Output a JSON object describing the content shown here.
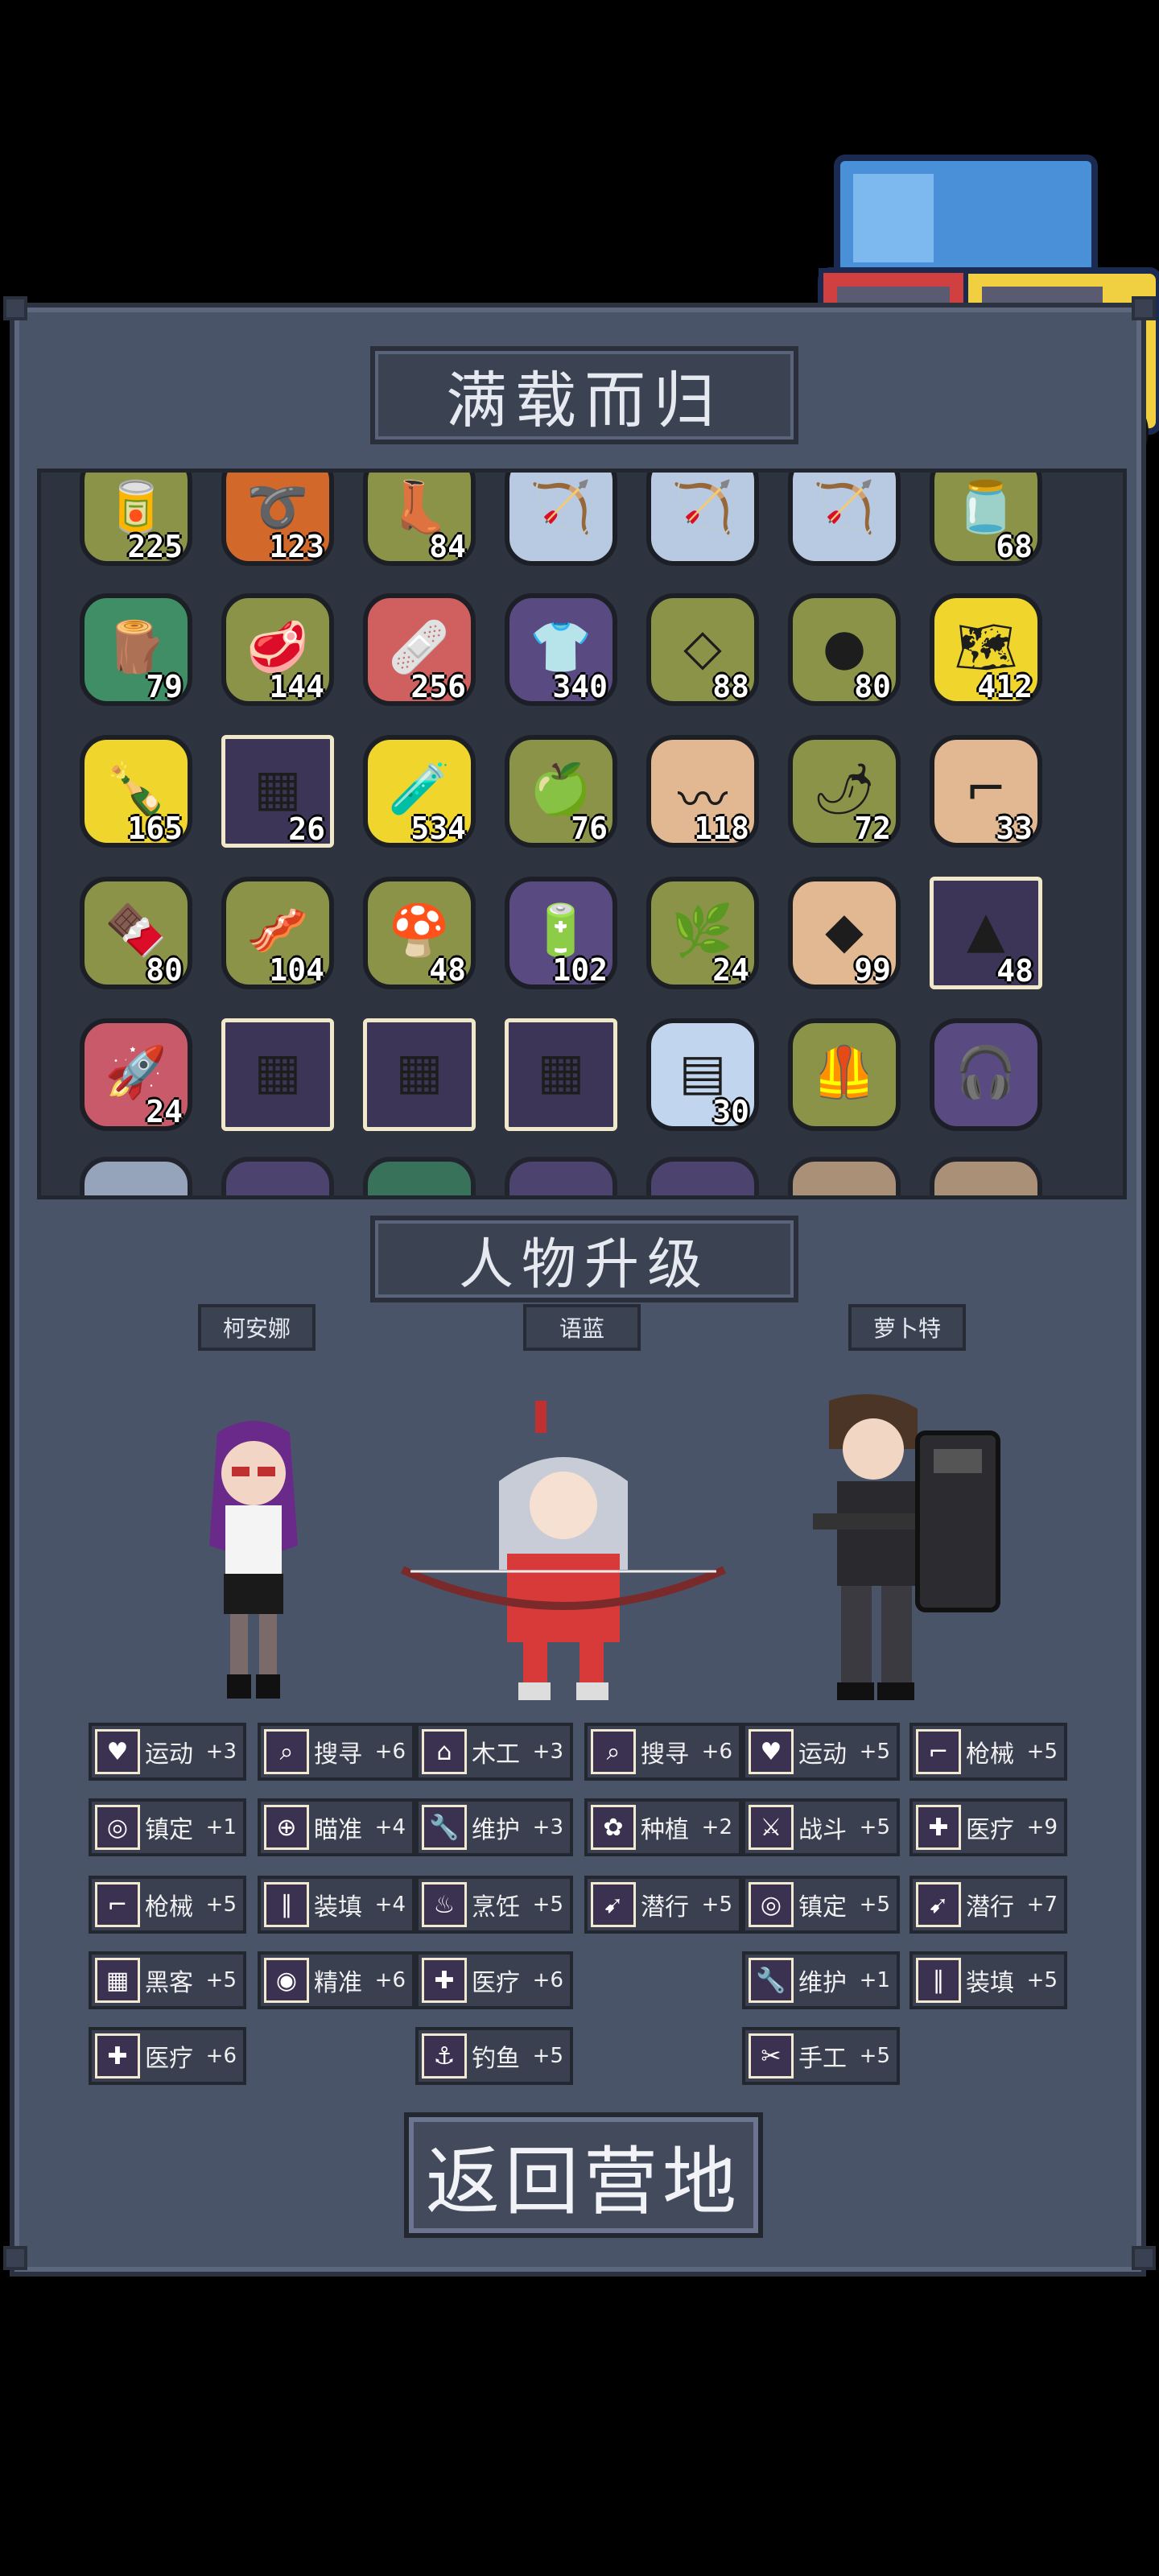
{
  "header": {
    "title": "满载而归"
  },
  "items": [
    {
      "icon": "food-can-icon",
      "glyph": "🥫",
      "color": "c-olive",
      "count": "225"
    },
    {
      "icon": "rope-icon",
      "glyph": "➰",
      "color": "c-orange",
      "count": "123"
    },
    {
      "icon": "boots-icon",
      "glyph": "👢",
      "color": "c-olive",
      "count": "84"
    },
    {
      "icon": "bow-icon",
      "glyph": "🏹",
      "color": "c-blue",
      "count": ""
    },
    {
      "icon": "bow-icon",
      "glyph": "🏹",
      "color": "c-blue",
      "count": ""
    },
    {
      "icon": "bow-icon",
      "glyph": "🏹",
      "color": "c-blue",
      "count": ""
    },
    {
      "icon": "jar-icon",
      "glyph": "🫙",
      "color": "c-olive",
      "count": "68"
    },
    {
      "icon": "wood-log-icon",
      "glyph": "🪵",
      "color": "c-green",
      "count": "79"
    },
    {
      "icon": "meat-icon",
      "glyph": "🥩",
      "color": "c-olive",
      "count": "144"
    },
    {
      "icon": "medkit-icon",
      "glyph": "🩹",
      "color": "c-red",
      "count": "256"
    },
    {
      "icon": "shirt-icon",
      "glyph": "👕",
      "color": "c-purple",
      "count": "340"
    },
    {
      "icon": "cloth-icon",
      "glyph": "◇",
      "color": "c-olive",
      "count": "88"
    },
    {
      "icon": "stone-icon",
      "glyph": "●",
      "color": "c-olive",
      "count": "80"
    },
    {
      "icon": "map-icon",
      "glyph": "🗺",
      "color": "c-yellow",
      "count": "412"
    },
    {
      "icon": "bottle-icon",
      "glyph": "🍾",
      "color": "c-yellow",
      "count": "165"
    },
    {
      "icon": "chip-icon",
      "glyph": "▦",
      "color": "c-chip",
      "count": "26"
    },
    {
      "icon": "potion-icon",
      "glyph": "🧪",
      "color": "c-yellow",
      "count": "534"
    },
    {
      "icon": "fruit-icon",
      "glyph": "🍏",
      "color": "c-olive",
      "count": "76"
    },
    {
      "icon": "wire-icon",
      "glyph": "〰",
      "color": "c-tan",
      "count": "118"
    },
    {
      "icon": "pepper-icon",
      "glyph": "🌶",
      "color": "c-olive",
      "count": "72"
    },
    {
      "icon": "rifle-icon",
      "glyph": "⌐",
      "color": "c-tan",
      "count": "33"
    },
    {
      "icon": "chocolate-icon",
      "glyph": "🍫",
      "color": "c-olive",
      "count": "80"
    },
    {
      "icon": "raw-meat-icon",
      "glyph": "🥓",
      "color": "c-olive",
      "count": "104"
    },
    {
      "icon": "mushroom-icon",
      "glyph": "🍄",
      "color": "c-olive",
      "count": "48"
    },
    {
      "icon": "battery-icon",
      "glyph": "🔋",
      "color": "c-purple",
      "count": "102"
    },
    {
      "icon": "herb-icon",
      "glyph": "🌿",
      "color": "c-olive",
      "count": "24"
    },
    {
      "icon": "ore-icon",
      "glyph": "◆",
      "color": "c-tan",
      "count": "99"
    },
    {
      "icon": "crystal-chip-icon",
      "glyph": "▲",
      "color": "c-chip",
      "count": "48"
    },
    {
      "icon": "rocket-icon",
      "glyph": "🚀",
      "color": "c-pink",
      "count": "24"
    },
    {
      "icon": "chip-icon",
      "glyph": "▦",
      "color": "c-chip",
      "count": ""
    },
    {
      "icon": "chip-icon",
      "glyph": "▦",
      "color": "c-chip",
      "count": ""
    },
    {
      "icon": "chip-icon",
      "glyph": "▦",
      "color": "c-chip",
      "count": ""
    },
    {
      "icon": "circuit-board-icon",
      "glyph": "▤",
      "color": "c-lightblue",
      "count": "30"
    },
    {
      "icon": "armor-vest-icon",
      "glyph": "🦺",
      "color": "c-olive",
      "count": ""
    },
    {
      "icon": "headphones-icon",
      "glyph": "🎧",
      "color": "c-purple",
      "count": ""
    }
  ],
  "upgrade": {
    "title": "人物升级"
  },
  "characters": [
    {
      "name": "柯安娜"
    },
    {
      "name": "语蓝"
    },
    {
      "name": "萝卜特"
    }
  ],
  "skills": {
    "col1": [
      {
        "icon": "heart-icon",
        "glyph": "♥",
        "name": "运动",
        "val": "+3"
      },
      {
        "icon": "glasses-icon",
        "glyph": "◎",
        "name": "镇定",
        "val": "+1"
      },
      {
        "icon": "gun-icon",
        "glyph": "⌐",
        "name": "枪械",
        "val": "+5"
      },
      {
        "icon": "hacker-icon",
        "glyph": "▦",
        "name": "黑客",
        "val": "+5"
      },
      {
        "icon": "medical-icon",
        "glyph": "✚",
        "name": "医疗",
        "val": "+6"
      }
    ],
    "col2": [
      {
        "icon": "magnifier-icon",
        "glyph": "⌕",
        "name": "搜寻",
        "val": "+6"
      },
      {
        "icon": "crosshair-icon",
        "glyph": "⊕",
        "name": "瞄准",
        "val": "+4"
      },
      {
        "icon": "ammo-icon",
        "glyph": "∥",
        "name": "装填",
        "val": "+4"
      },
      {
        "icon": "eye-icon",
        "glyph": "◉",
        "name": "精准",
        "val": "+6"
      }
    ],
    "col3": [
      {
        "icon": "house-icon",
        "glyph": "⌂",
        "name": "木工",
        "val": "+3"
      },
      {
        "icon": "wrench-icon",
        "glyph": "🔧",
        "name": "维护",
        "val": "+3"
      },
      {
        "icon": "cooking-pot-icon",
        "glyph": "♨",
        "name": "烹饪",
        "val": "+5"
      },
      {
        "icon": "medical-icon",
        "glyph": "✚",
        "name": "医疗",
        "val": "+6"
      },
      {
        "icon": "fishing-icon",
        "glyph": "⚓",
        "name": "钓鱼",
        "val": "+5"
      }
    ],
    "col4": [
      {
        "icon": "magnifier-icon",
        "glyph": "⌕",
        "name": "搜寻",
        "val": "+6"
      },
      {
        "icon": "plant-icon",
        "glyph": "✿",
        "name": "种植",
        "val": "+2"
      },
      {
        "icon": "sneak-icon",
        "glyph": "➹",
        "name": "潜行",
        "val": "+5"
      }
    ],
    "col5": [
      {
        "icon": "heart-icon",
        "glyph": "♥",
        "name": "运动",
        "val": "+5"
      },
      {
        "icon": "fight-icon",
        "glyph": "⚔",
        "name": "战斗",
        "val": "+5"
      },
      {
        "icon": "glasses-icon",
        "glyph": "◎",
        "name": "镇定",
        "val": "+5"
      },
      {
        "icon": "wrench-icon",
        "glyph": "🔧",
        "name": "维护",
        "val": "+1"
      },
      {
        "icon": "scissors-icon",
        "glyph": "✂",
        "name": "手工",
        "val": "+5"
      }
    ],
    "col6": [
      {
        "icon": "gun-icon",
        "glyph": "⌐",
        "name": "枪械",
        "val": "+5"
      },
      {
        "icon": "medical-icon",
        "glyph": "✚",
        "name": "医疗",
        "val": "+9"
      },
      {
        "icon": "sneak-icon",
        "glyph": "➹",
        "name": "潜行",
        "val": "+7"
      },
      {
        "icon": "ammo-icon",
        "glyph": "∥",
        "name": "装填",
        "val": "+5"
      }
    ]
  },
  "footer": {
    "return_label": "返回营地"
  }
}
